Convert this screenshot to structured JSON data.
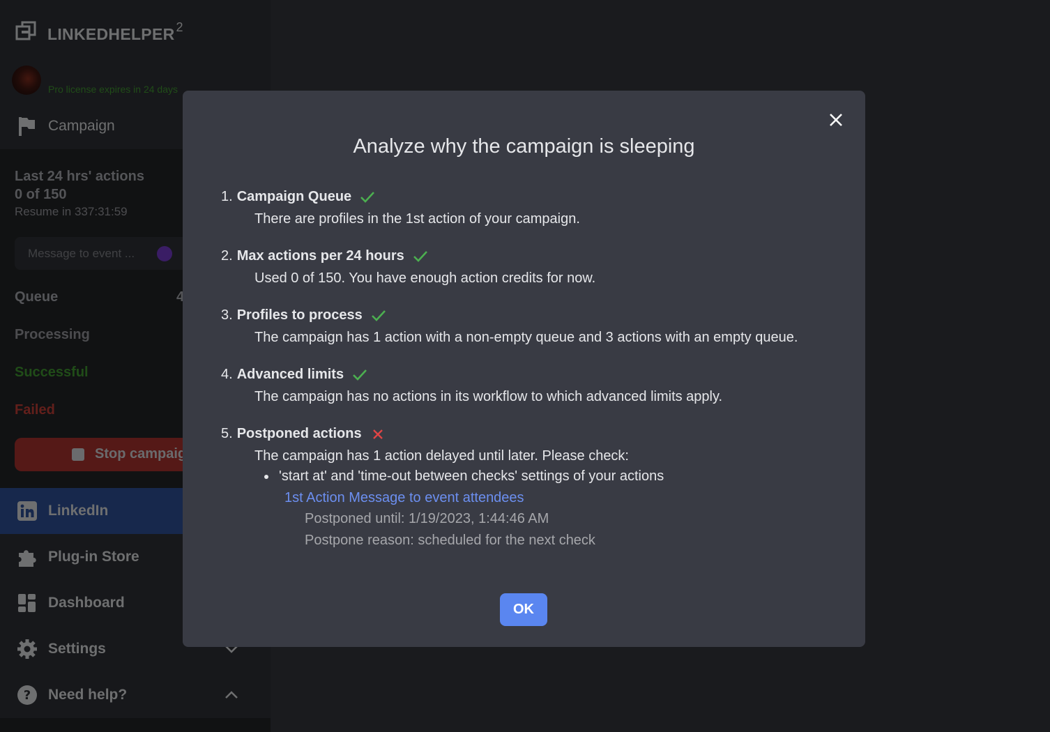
{
  "sidebar": {
    "logo_text": "LINKEDHELPER",
    "logo_sup": "2",
    "license": "Pro license expires in 24 days",
    "campaign_label": "Campaign",
    "stats_title_line1": "Last 24 hrs' actions",
    "stats_title_line2": "0 of 150",
    "resume": "Resume in 337:31:59",
    "message_placeholder": "Message to event ...",
    "queue_label": "Queue",
    "queue_count": "4",
    "processing_label": "Processing",
    "successful_label": "Successful",
    "failed_label": "Failed",
    "stop_label": "Stop campaign",
    "nav": {
      "linkedin": "LinkedIn",
      "plugin_store": "Plug-in Store",
      "dashboard": "Dashboard",
      "settings": "Settings",
      "need_help": "Need help?"
    },
    "colors": {
      "successful": "#3b8a2d",
      "failed": "#b33a32",
      "active_nav": "#2a4a8a"
    }
  },
  "modal": {
    "title": "Analyze why the campaign is sleeping",
    "items": [
      {
        "num": "1.",
        "name": "Campaign Queue",
        "status": "ok",
        "desc": "There are profiles in the 1st action of your campaign."
      },
      {
        "num": "2.",
        "name": "Max actions per 24 hours",
        "status": "ok",
        "desc": "Used 0 of 150. You have enough action credits for now."
      },
      {
        "num": "3.",
        "name": "Profiles to process",
        "status": "ok",
        "desc": "The campaign has 1 action with a non-empty queue and 3 actions with an empty queue."
      },
      {
        "num": "4.",
        "name": "Advanced limits",
        "status": "ok",
        "desc": "The campaign has no actions in its workflow to which advanced limits apply."
      },
      {
        "num": "5.",
        "name": "Postponed actions",
        "status": "fail",
        "desc": "The campaign has 1 action delayed until later. Please check:"
      }
    ],
    "bullet": "'start at' and 'time-out between checks' settings of your actions",
    "action_link": "1st Action Message to event attendees",
    "postponed_until": "Postponed until: 1/19/2023, 1:44:46 AM",
    "postpone_reason": "Postpone reason: scheduled for the next check",
    "ok_label": "OK",
    "colors": {
      "check": "#4caf50",
      "cross": "#e04545",
      "link": "#6c8ff0",
      "ok_button": "#5a86f0"
    }
  }
}
